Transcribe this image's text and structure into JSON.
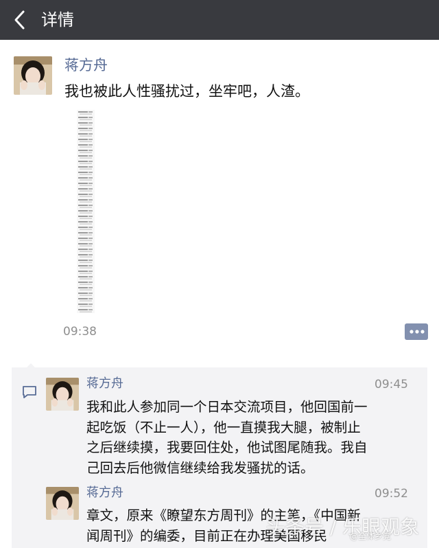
{
  "header": {
    "title": "详情",
    "back_icon": "chevron-left-icon",
    "background": "#393a3f"
  },
  "post": {
    "author": "蒋方舟",
    "text": "我也被此人性骚扰过，坐牢吧，人渣。",
    "time": "09:38",
    "more_icon": "ellipsis-icon"
  },
  "comments": [
    {
      "author": "蒋方舟",
      "time": "09:45",
      "lines": [
        "我和此人参加同一个日本交流项目，他回国前一",
        "起吃饭（不止一人），他一直摸我大腿，被制止",
        "之后继续摸，我要回住处，他试图尾随我。我自",
        "己回去后他微信继续给我发骚扰的话。"
      ]
    },
    {
      "author": "蒋方舟",
      "time": "09:52",
      "lines": [
        "章文，原来《瞭望东方周刊》的主笔，《中国新",
        "闻周刊》的编委，目前正在办理美国移民"
      ]
    }
  ],
  "watermark": {
    "text": "头条号 / 乐眼观象",
    "handle": "@全体乡党"
  },
  "colors": {
    "link": "#576b95",
    "time": "#8e8e8e",
    "comment_bg": "#f3f3f5"
  }
}
